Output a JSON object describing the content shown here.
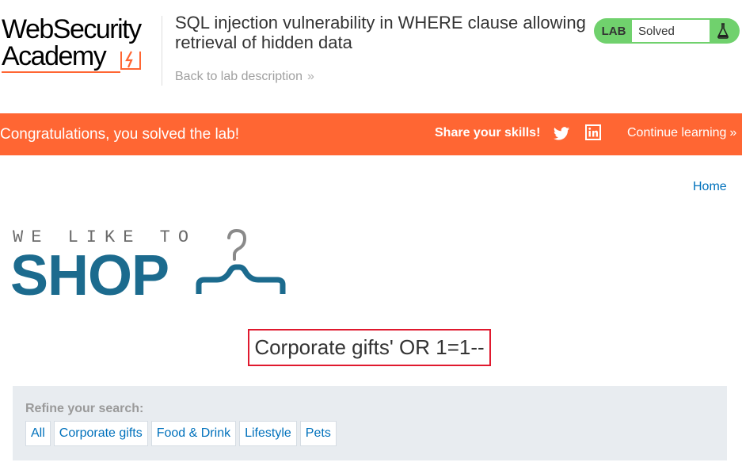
{
  "header": {
    "logo_line1": "WebSecurity",
    "logo_line2": "Academy",
    "lab_title": "SQL injection vulnerability in WHERE clause allowing retrieval of hidden data",
    "back_link": "Back to lab description",
    "back_chevron": "»",
    "lab_label": "LAB",
    "lab_status": "Solved",
    "status_color": "#70d16d"
  },
  "banner": {
    "congrats": "Congratulations, you solved the lab!",
    "share": "Share your skills!",
    "continue": "Continue learning",
    "continue_chevron": "»",
    "color": "#ff6633",
    "icons": [
      "twitter-icon",
      "linkedin-icon"
    ]
  },
  "nav": {
    "home": "Home"
  },
  "shop_logo": {
    "tagline": "WE LIKE TO",
    "wordmark": "SHOP",
    "color": "#1c6b8e"
  },
  "search": {
    "heading": "Corporate gifts' OR 1=1--",
    "highlight_color": "#e0192e"
  },
  "filters": {
    "label": "Refine your search:",
    "items": [
      "All",
      "Corporate gifts",
      "Food & Drink",
      "Lifestyle",
      "Pets"
    ],
    "link_color": "#0071bc"
  }
}
